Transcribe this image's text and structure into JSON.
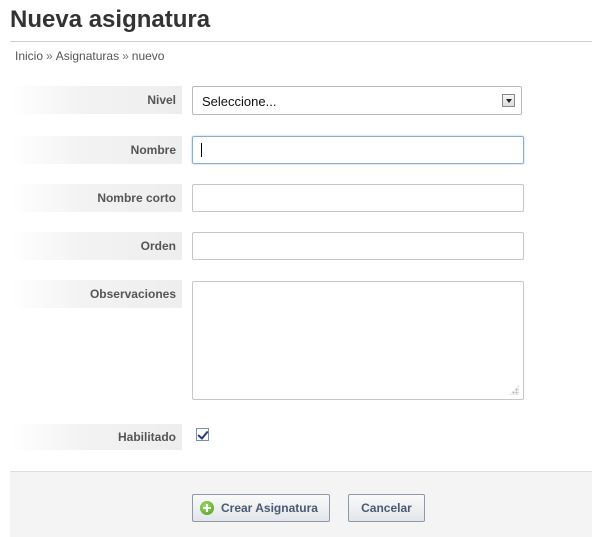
{
  "page": {
    "title": "Nueva asignatura"
  },
  "breadcrumb": {
    "items": [
      "Inicio",
      "Asignaturas",
      "nuevo"
    ],
    "separator": "»"
  },
  "form": {
    "nivel": {
      "label": "Nivel",
      "selected": "Seleccione..."
    },
    "nombre": {
      "label": "Nombre",
      "value": ""
    },
    "nombre_corto": {
      "label": "Nombre corto",
      "value": ""
    },
    "orden": {
      "label": "Orden",
      "value": ""
    },
    "observaciones": {
      "label": "Observaciones",
      "value": ""
    },
    "habilitado": {
      "label": "Habilitado",
      "checked": true
    }
  },
  "actions": {
    "create_label": "Crear Asignatura",
    "create_icon": "plus-circle-icon",
    "cancel_label": "Cancelar"
  },
  "colors": {
    "focus_border": "#85b0d4",
    "button_text": "#4a5a72",
    "create_icon": "#4a9a1c"
  }
}
